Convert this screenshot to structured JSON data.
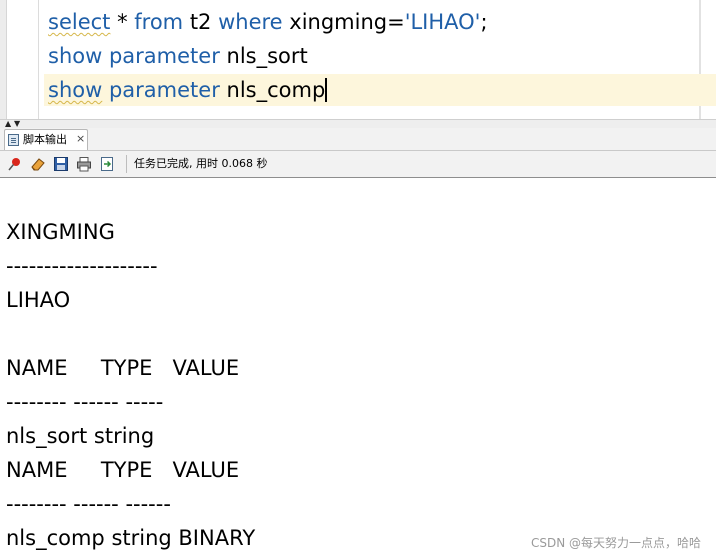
{
  "editor": {
    "line1": {
      "kw1": "select",
      "star": " * ",
      "kw2": "from",
      "tbl": " t2 ",
      "kw3": "where",
      "col": " xingming=",
      "str": "'LIHAO'",
      "end": ";"
    },
    "line2": {
      "kw1": "show",
      "kw2": " parameter",
      "rest": " nls_sort"
    },
    "line3": {
      "kw1": "show",
      "kw2": " parameter",
      "rest": " nls_comp"
    }
  },
  "output_panel": {
    "tab_label": "脚本输出",
    "tab_close": "×",
    "status_text": "任务已完成, 用时 0.068 秒",
    "toolbar_icons": [
      "pin-icon",
      "eraser-icon",
      "save-icon",
      "print-icon",
      "export-icon"
    ]
  },
  "output_lines": [
    "XINGMING",
    "--------------------",
    "LIHAO",
    "",
    "NAME     TYPE   VALUE",
    "-------- ------ -----",
    "nls_sort string",
    "NAME     TYPE   VALUE",
    "-------- ------ ------",
    "nls_comp string BINARY"
  ],
  "watermark": "CSDN @每天努力一点点，哈哈"
}
